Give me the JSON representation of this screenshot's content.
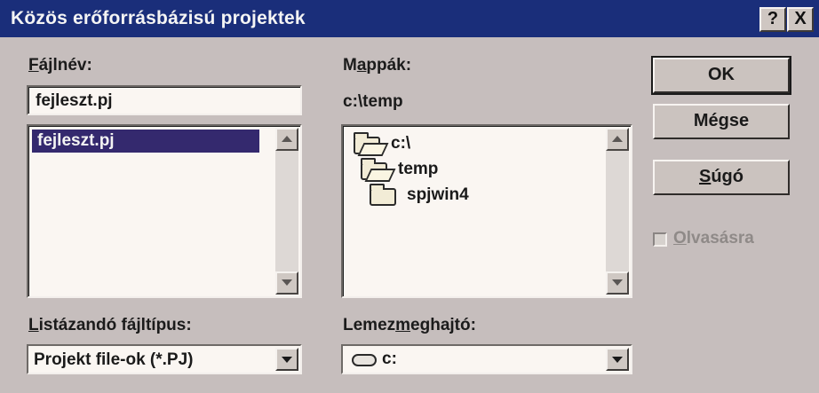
{
  "window": {
    "title": "Közös erőforrásbázisú projektek",
    "help_glyph": "?",
    "close_glyph": "X"
  },
  "filename": {
    "label_access": "F",
    "label_rest": "ájlnév:",
    "value": "fejleszt.pj",
    "list": [
      "fejleszt.pj"
    ]
  },
  "folders": {
    "label_pre": "M",
    "label_access": "a",
    "label_rest": "ppák:",
    "current_path": "c:\\temp",
    "items": [
      {
        "name": "c:\\",
        "icon": "open-folder-icon"
      },
      {
        "name": "temp",
        "icon": "open-folder-icon"
      },
      {
        "name": "spjwin4",
        "icon": "folder-icon"
      }
    ]
  },
  "file_type": {
    "label_access": "L",
    "label_rest": "istázandó fájltípus:",
    "value": "Projekt file-ok (*.PJ)"
  },
  "drive": {
    "label_pre": "Lemez",
    "label_access": "m",
    "label_rest": "eghajtó:",
    "value": "c:",
    "icon": "drive-icon"
  },
  "buttons": {
    "ok": "OK",
    "cancel": "Mégse",
    "help_access": "S",
    "help_rest": "úgó"
  },
  "readonly": {
    "label_access": "O",
    "label_rest": "lvasásra",
    "checked": false
  }
}
